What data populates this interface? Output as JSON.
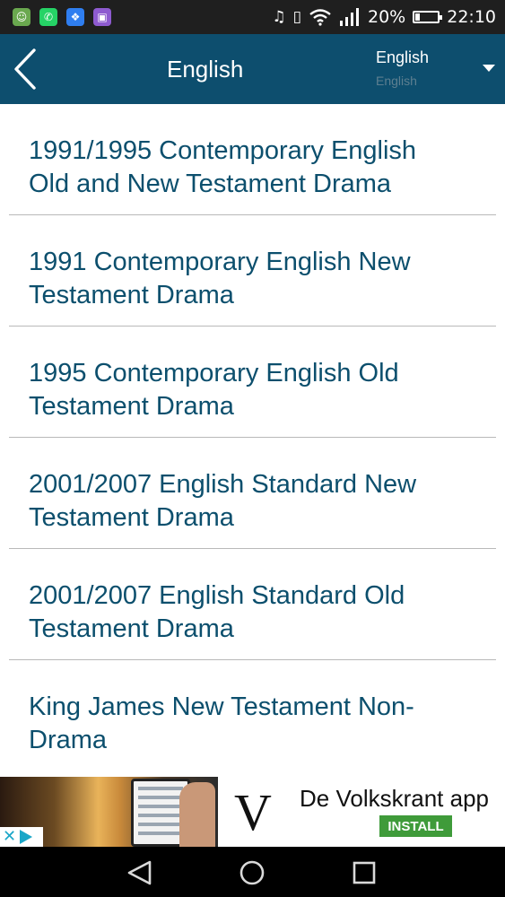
{
  "status_bar": {
    "notification_icons": [
      {
        "icon": "app-notification-icon",
        "color": "#6aa84f",
        "glyph": "☺"
      },
      {
        "icon": "whatsapp-icon",
        "color": "#25d366",
        "glyph": "✆"
      },
      {
        "icon": "dropbox-icon",
        "color": "#2f7ef0",
        "glyph": "❖"
      },
      {
        "icon": "gallery-icon",
        "color": "#8e5bd0",
        "glyph": "▣"
      }
    ],
    "battery": "20%",
    "time": "22:10"
  },
  "app_bar": {
    "title": "English",
    "language_select": {
      "selected": "English",
      "behind": "English"
    }
  },
  "list": {
    "items": [
      {
        "label": "1991/1995 Contemporary English Old and New Testament Drama"
      },
      {
        "label": "1991 Contemporary English New Testament Drama"
      },
      {
        "label": "1995 Contemporary English Old Testament Drama"
      },
      {
        "label": "2001/2007 English Standard New Testament Drama"
      },
      {
        "label": "2001/2007 English Standard Old Testament Drama"
      },
      {
        "label": "King James New Testament Non-Drama"
      }
    ]
  },
  "ad": {
    "logo_letter": "V",
    "app_name": "De Volkskrant app",
    "install_label": "INSTALL",
    "install_color": "#3f9b3a"
  },
  "colors": {
    "app_bar": "#0d4e6e",
    "item_text": "#0c4f6d",
    "divider": "#b9b9b9"
  }
}
